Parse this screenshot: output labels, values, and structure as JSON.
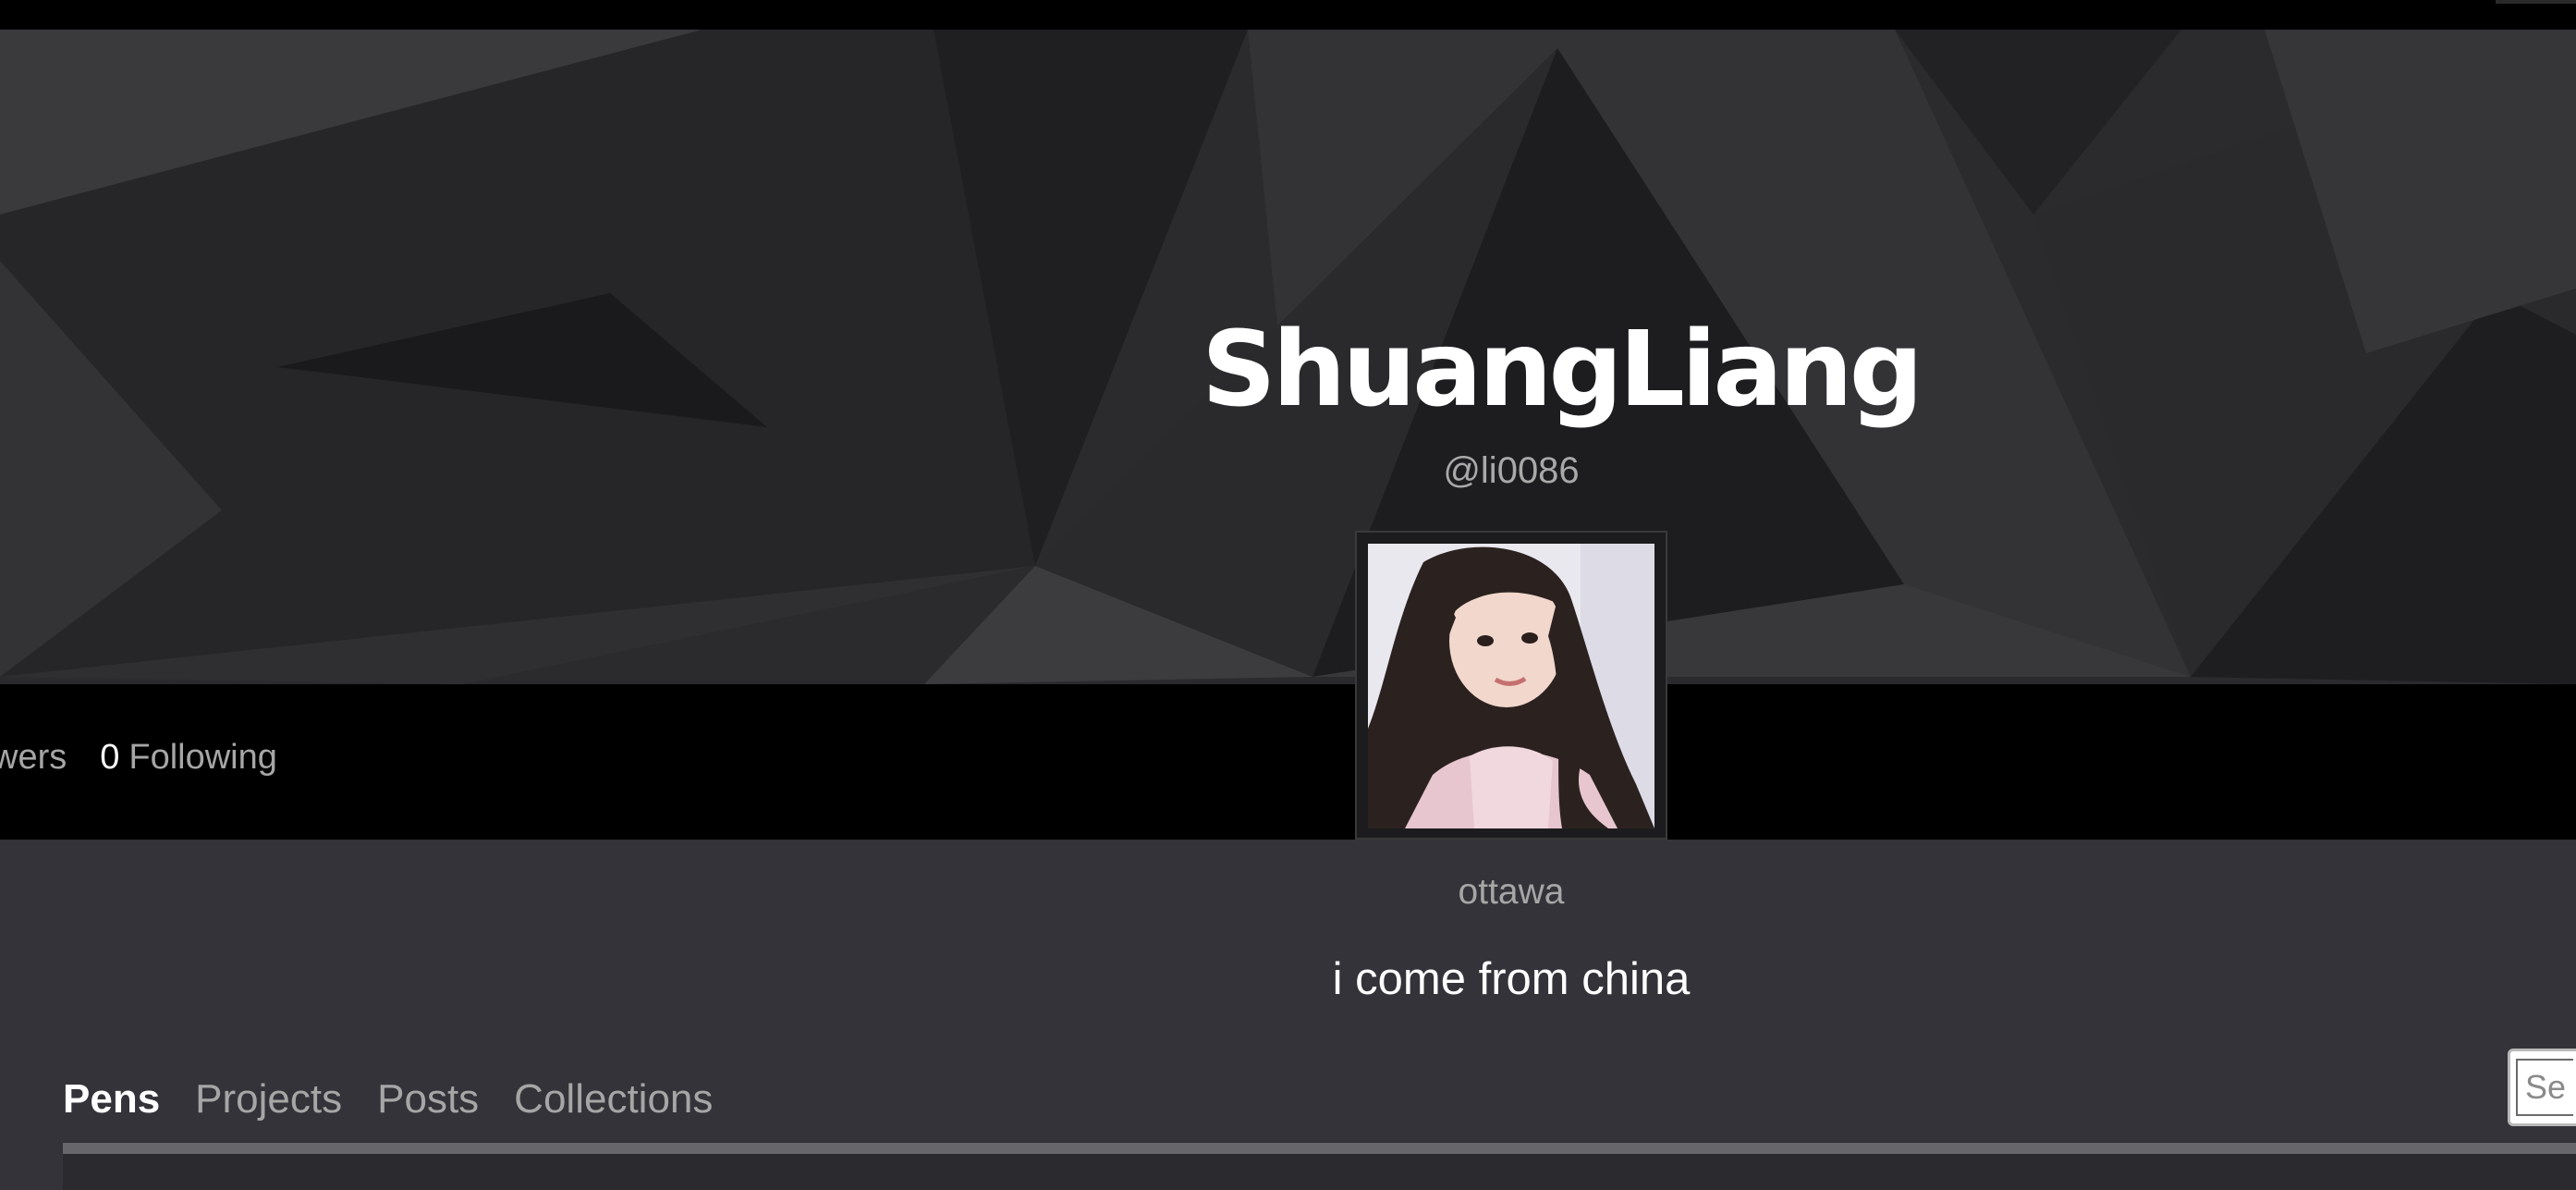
{
  "profile": {
    "name": "ShuangLiang",
    "handle": "@li0086",
    "location": "ottawa",
    "bio": "i come from china"
  },
  "stats": {
    "followers_label_partial": "wers",
    "following_count": "0",
    "following_label": "Following"
  },
  "tabs": [
    {
      "label": "Pens",
      "active": true
    },
    {
      "label": "Projects",
      "active": false
    },
    {
      "label": "Posts",
      "active": false
    },
    {
      "label": "Collections",
      "active": false
    }
  ],
  "search": {
    "placeholder": "Search"
  },
  "colors": {
    "page_background": "#343339",
    "hero_background": "#2c2c2e",
    "stats_bar": "#000000",
    "primary_text": "#ffffff",
    "muted_text": "#a6a6a6"
  }
}
